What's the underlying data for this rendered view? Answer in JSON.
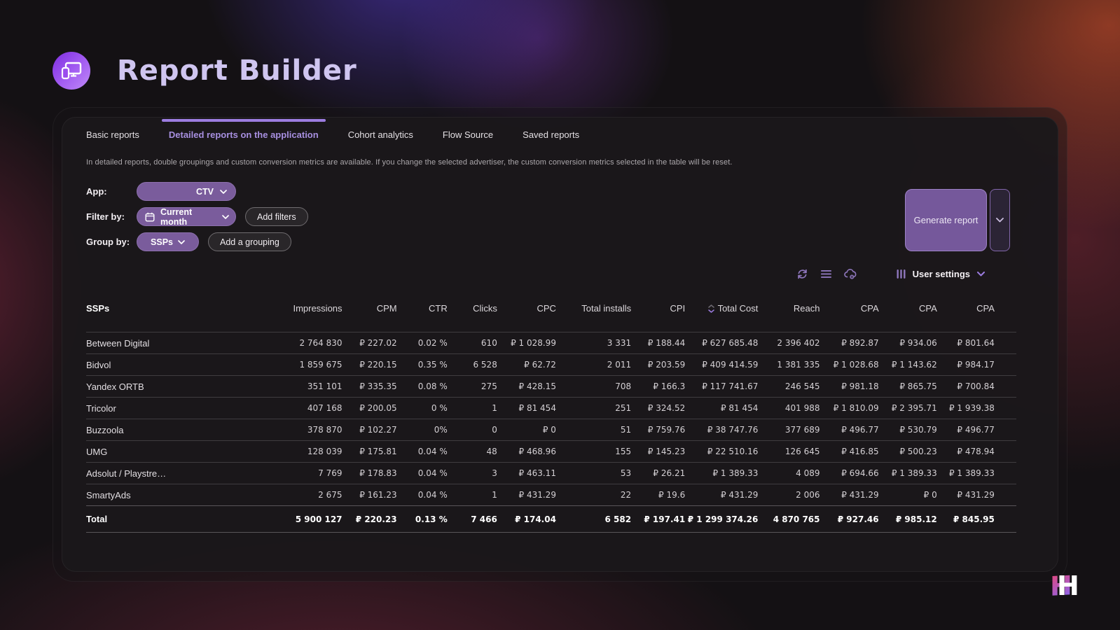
{
  "header": {
    "title": "Report Builder"
  },
  "tabs": [
    {
      "label": "Basic reports",
      "active": false
    },
    {
      "label": "Detailed reports on the application",
      "active": true
    },
    {
      "label": "Cohort analytics",
      "active": false
    },
    {
      "label": "Flow Source",
      "active": false
    },
    {
      "label": "Saved reports",
      "active": false
    }
  ],
  "note": "In detailed reports, double groupings and custom conversion metrics are available. If you change the selected advertiser, the custom conversion metrics selected in the table will be reset.",
  "filters": {
    "app_label": "App:",
    "app_value": "CTV",
    "filter_by_label": "Filter by:",
    "filter_value": "Current month",
    "add_filters_label": "Add filters",
    "group_by_label": "Group by:",
    "group_value": "SSPs",
    "add_grouping_label": "Add a grouping"
  },
  "actions": {
    "generate_label": "Generate report",
    "user_settings_label": "User settings"
  },
  "icons": {
    "logo": "devices-icon",
    "calendar": "calendar-icon",
    "chevron": "chevron-down-icon",
    "refresh": "refresh-icon",
    "menu": "hamburger-icon",
    "cloud": "cloud-settings-icon",
    "columns": "columns-icon",
    "sort": "sort-desc-icon",
    "brand": "h-brand-logo"
  },
  "colors": {
    "accent_purple": "#9c7ce0",
    "pill_purple": "#7a5c9c",
    "button_purple": "#75589b",
    "panel_bg": "#1b181b",
    "glow_red": "#d6522d",
    "glow_violet": "#553acd",
    "brand_pink": "#ee4470",
    "brand_violet": "#8f63e8"
  },
  "table": {
    "columns": [
      {
        "label": "SSPs",
        "align": "left",
        "bold": true
      },
      {
        "label": "Impressions"
      },
      {
        "label": "CPM"
      },
      {
        "label": "CTR"
      },
      {
        "label": "Clicks"
      },
      {
        "label": "CPC"
      },
      {
        "label": "Total installs"
      },
      {
        "label": "CPI"
      },
      {
        "label": "Total Cost",
        "sorted": "desc"
      },
      {
        "label": "Reach"
      },
      {
        "label": "CPA"
      },
      {
        "label": "CPA"
      },
      {
        "label": "CPA"
      }
    ],
    "rows": [
      {
        "name": "Between Digital",
        "values": [
          "2 764 830",
          "₽ 227.02",
          "0.02 %",
          "610",
          "₽ 1 028.99",
          "3 331",
          "₽ 188.44",
          "₽ 627 685.48",
          "2 396 402",
          "₽ 892.87",
          "₽ 934.06",
          "₽ 801.64"
        ]
      },
      {
        "name": "Bidvol",
        "values": [
          "1 859 675",
          "₽ 220.15",
          "0.35 %",
          "6 528",
          "₽ 62.72",
          "2 011",
          "₽ 203.59",
          "₽ 409 414.59",
          "1 381 335",
          "₽ 1 028.68",
          "₽ 1 143.62",
          "₽ 984.17"
        ]
      },
      {
        "name": "Yandex ORTB",
        "values": [
          "351 101",
          "₽ 335.35",
          "0.08 %",
          "275",
          "₽ 428.15",
          "708",
          "₽ 166.3",
          "₽ 117 741.67",
          "246 545",
          "₽ 981.18",
          "₽ 865.75",
          "₽ 700.84"
        ]
      },
      {
        "name": "Tricolor",
        "values": [
          "407 168",
          "₽ 200.05",
          "0 %",
          "1",
          "₽ 81 454",
          "251",
          "₽ 324.52",
          "₽ 81 454",
          "401 988",
          "₽ 1 810.09",
          "₽ 2 395.71",
          "₽ 1 939.38"
        ]
      },
      {
        "name": "Buzzoola",
        "values": [
          "378 870",
          "₽ 102.27",
          "0%",
          "0",
          "₽ 0",
          "51",
          "₽ 759.76",
          "₽ 38 747.76",
          "377 689",
          "₽ 496.77",
          "₽ 530.79",
          "₽ 496.77"
        ]
      },
      {
        "name": "UMG",
        "values": [
          "128 039",
          "₽ 175.81",
          "0.04 %",
          "48",
          "₽ 468.96",
          "155",
          "₽ 145.23",
          "₽ 22 510.16",
          "126 645",
          "₽ 416.85",
          "₽ 500.23",
          "₽ 478.94"
        ]
      },
      {
        "name": "Adsolut / Playstre…",
        "values": [
          "7 769",
          "₽ 178.83",
          "0.04 %",
          "3",
          "₽ 463.11",
          "53",
          "₽ 26.21",
          "₽ 1 389.33",
          "4 089",
          "₽ 694.66",
          "₽ 1 389.33",
          "₽ 1 389.33"
        ]
      },
      {
        "name": "SmartyAds",
        "values": [
          "2 675",
          "₽ 161.23",
          "0.04 %",
          "1",
          "₽ 431.29",
          "22",
          "₽ 19.6",
          "₽ 431.29",
          "2 006",
          "₽ 431.29",
          "₽ 0",
          "₽ 431.29"
        ]
      }
    ],
    "total_row": {
      "name": "Total",
      "values": [
        "5 900 127",
        "₽ 220.23",
        "0.13 %",
        "7 466",
        "₽ 174.04",
        "6 582",
        "₽ 197.41",
        "₽ 1 299 374.26",
        "4 870 765",
        "₽ 927.46",
        "₽ 985.12",
        "₽ 845.95"
      ]
    }
  }
}
